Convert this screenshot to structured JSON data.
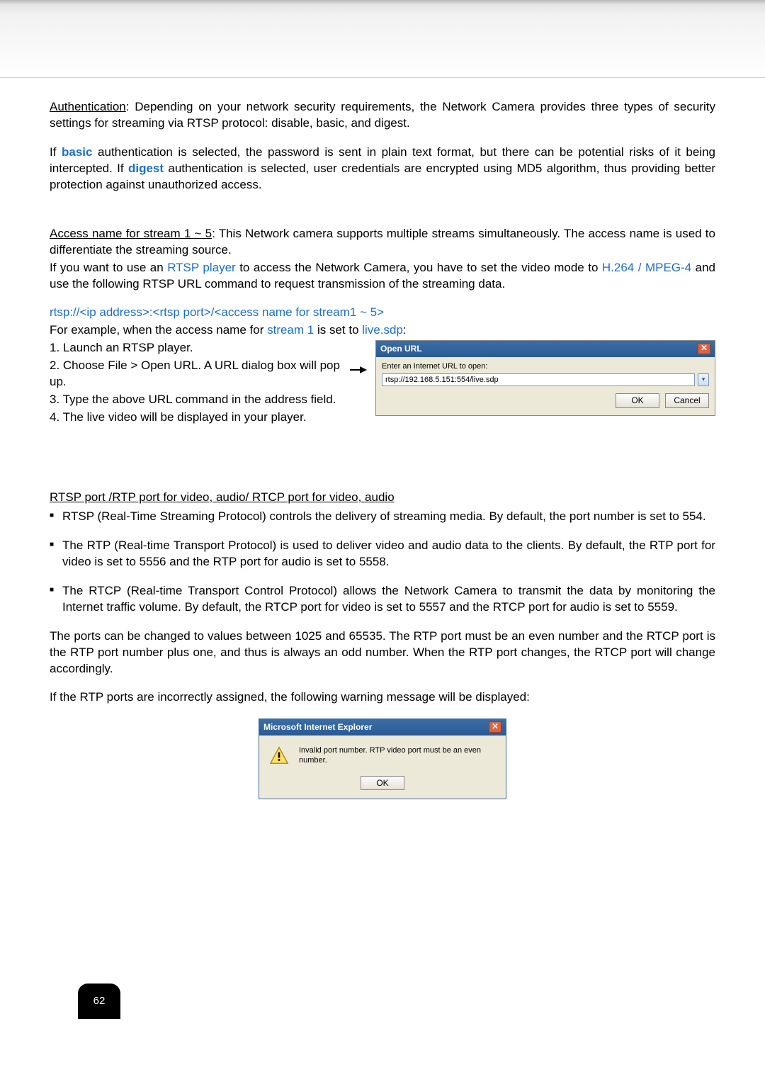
{
  "auth": {
    "section_label": "Authentication",
    "desc_tail": ": Depending on your network security requirements, the Network Camera provides three types of security settings for streaming via RTSP protocol: disable, basic, and digest.",
    "basic_pre": "If ",
    "basic_kw": "basic",
    "basic_mid": " authentication is selected, the password is sent in plain text format, but there can be potential risks of it being intercepted. If ",
    "digest_kw": "digest",
    "basic_post": " authentication is selected, user credentials are encrypted using MD5 algorithm, thus providing better protection against unauthorized access."
  },
  "access": {
    "label": "Access name for stream 1 ~ 5",
    "desc_tail": ": This Network camera supports multiple streams simultaneously. The access name is used to differentiate the streaming source.",
    "l2_pre": "If you want to use an ",
    "l2_kw1": "RTSP player",
    "l2_mid": " to access the Network Camera, you have to set the video mode to ",
    "l2_kw2": "H.264 / MPEG-4",
    "l2_post": " and use the following RTSP URL command to request transmission of the streaming data.",
    "url_template": "rtsp://<ip address>:<rtsp port>/<access name for stream1 ~ 5>",
    "example_pre": "For example, when the access name for ",
    "example_kw1": "stream 1",
    "example_mid": " is set to ",
    "example_kw2": "live.sdp",
    "example_post": ":",
    "steps": [
      "1. Launch an RTSP player.",
      "2. Choose File > Open URL. A URL dialog box will pop up.",
      "3. Type the above URL command in the address field.",
      "4. The live video will be displayed in your player."
    ]
  },
  "open_url_dialog": {
    "title": "Open URL",
    "label": "Enter an Internet URL to open:",
    "value": "rtsp://192.168.5.151:554/live.sdp",
    "ok": "OK",
    "cancel": "Cancel"
  },
  "rtsp_ports": {
    "heading": "RTSP port /RTP port for video, audio/ RTCP port for video, audio",
    "bullets": [
      "RTSP (Real-Time Streaming Protocol) controls the delivery of streaming media. By default, the port number is set to 554.",
      "The RTP (Real-time Transport Protocol) is used to deliver video and audio data to the clients. By default, the RTP port for video is set to 5556 and the RTP port for audio is set to 5558.",
      "The RTCP (Real-time Transport Control Protocol) allows the Network Camera to transmit the data by monitoring the Internet traffic volume. By default, the RTCP port for video is set to 5557 and the RTCP port for audio is set to 5559."
    ],
    "range_note": "The ports can be changed to values between 1025 and 65535. The RTP port must be an even number and the RTCP port is the RTP port number plus one, and thus is always an odd number. When the RTP port changes, the RTCP port will change accordingly.",
    "warn_intro": "If the RTP ports are incorrectly assigned, the following warning message will be displayed:"
  },
  "ie_dialog": {
    "title": "Microsoft Internet Explorer",
    "message": "Invalid port number. RTP video port must be an even number.",
    "ok": "OK"
  },
  "page_number": "62"
}
